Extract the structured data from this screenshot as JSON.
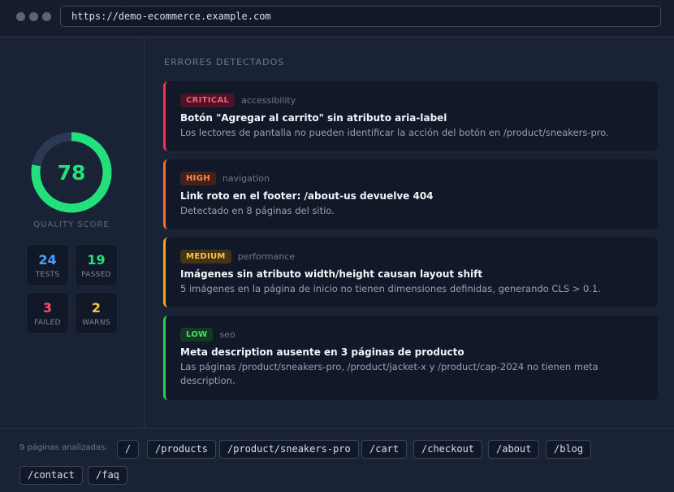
{
  "browser": {
    "url": "https://demo-ecommerce.example.com"
  },
  "score": {
    "value": "78",
    "percent": 78,
    "label": "QUALITY SCORE",
    "color": "#22e07a"
  },
  "stats": {
    "tests": {
      "value": "24",
      "label": "TESTS"
    },
    "passed": {
      "value": "19",
      "label": "PASSED"
    },
    "failed": {
      "value": "3",
      "label": "FAILED"
    },
    "warns": {
      "value": "2",
      "label": "WARNS"
    }
  },
  "errors_title": "ERRORES DETECTADOS",
  "errors": [
    {
      "severity": "CRITICAL",
      "category": "accessibility",
      "title": "Botón \"Agregar al carrito\" sin atributo aria-label",
      "description": "Los lectores de pantalla no pueden identificar la acción del botón en /product/sneakers-pro."
    },
    {
      "severity": "HIGH",
      "category": "navigation",
      "title": "Link roto en el footer: /about-us devuelve 404",
      "description": "Detectado en 8 páginas del sitio."
    },
    {
      "severity": "MEDIUM",
      "category": "performance",
      "title": "Imágenes sin atributo width/height causan layout shift",
      "description": "5 imágenes en la página de inicio no tienen dimensiones definidas, generando CLS > 0.1."
    },
    {
      "severity": "LOW",
      "category": "seo",
      "title": "Meta description ausente en 3 páginas de producto",
      "description": "Las páginas /product/sneakers-pro, /product/jacket-x y /product/cap-2024 no tienen meta description."
    }
  ],
  "footer": {
    "label": "9 páginas analizadas:",
    "pages": [
      "/",
      "/products",
      "/product/sneakers-pro",
      "/cart",
      "/checkout",
      "/about",
      "/blog",
      "/contact",
      "/faq"
    ]
  }
}
